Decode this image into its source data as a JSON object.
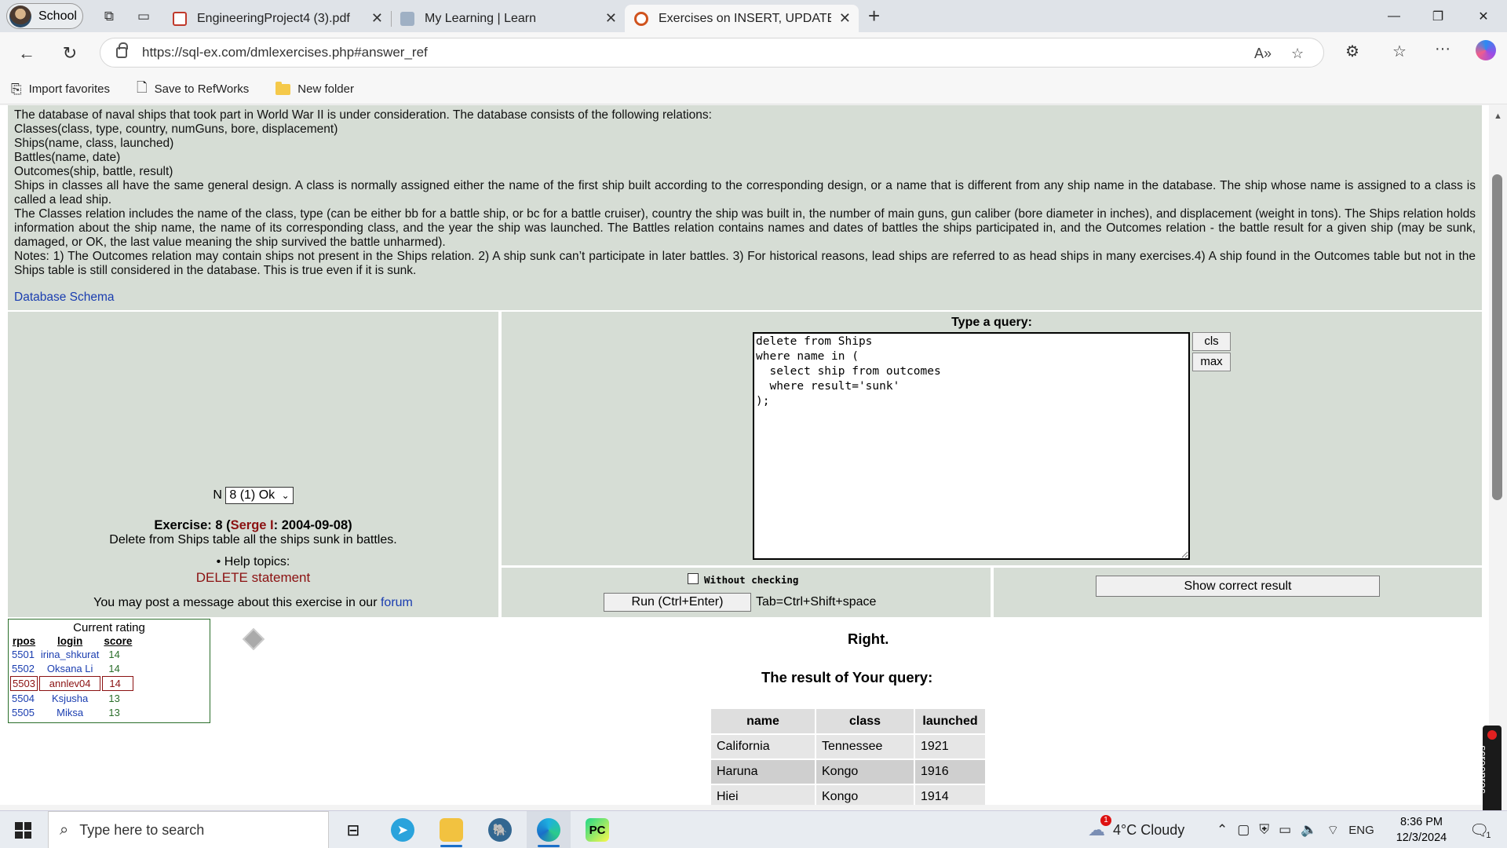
{
  "browser": {
    "profile_label": "School",
    "tabs": [
      {
        "title": "EngineeringProject4 (3).pdf",
        "icon": "pdf-icon"
      },
      {
        "title": "My Learning | Learn",
        "icon": "learn-icon"
      },
      {
        "title": "Exercises on INSERT, UPDATE, DEL",
        "icon": "sql-ex-icon"
      }
    ],
    "url": "https://sql-ex.com/dmlexercises.php#answer_ref",
    "favorites": [
      "Import favorites",
      "Save to RefWorks",
      "New folder"
    ]
  },
  "intro": {
    "lines": [
      "The database of naval ships that took part in World War II is under consideration. The database consists of the following relations:",
      "Classes(class, type, country, numGuns, bore, displacement)",
      "Ships(name, class, launched)",
      "Battles(name, date)",
      "Outcomes(ship, battle, result)",
      "Ships in classes all have the same general design. A class is normally assigned either the name of the first ship built according to the corresponding design, or a name that is different from any ship name in the database. The ship whose name is assigned to a class is called a lead ship.",
      "The Classes relation includes the name of the class, type (can be either bb for a battle ship, or bc for a battle cruiser), country the ship was built in, the number of main guns, gun caliber (bore diameter in inches), and displacement (weight in tons). The Ships relation holds information about the ship name, the name of its corresponding class, and the year the ship was launched. The Battles relation contains names and dates of battles the ships participated in, and the Outcomes relation - the battle result for a given ship (may be sunk, damaged, or OK, the last value meaning the ship survived the battle unharmed).",
      "Notes: 1) The Outcomes relation may contain ships not present in the Ships relation. 2) A ship sunk can’t participate in later battles. 3) For historical reasons, lead ships are referred to as head ships in many exercises.4) A ship found in the Outcomes table but not in the Ships table is still considered in the database. This is true even if it is sunk."
    ],
    "schema_link": "Database Schema"
  },
  "exercise": {
    "n_label": "N",
    "selected": "8 (1) Ok",
    "title_prefix": "Exercise: 8 (",
    "author": "Serge I",
    "title_suffix": ": 2004-09-08)",
    "description": "Delete from Ships table all the ships sunk in battles.",
    "help_label": "• Help topics:",
    "help_link": "DELETE statement",
    "forum_text": "You may post a message about this exercise in our",
    "forum_link": "forum"
  },
  "query": {
    "title": "Type a query:",
    "text": "delete from Ships\nwhere name in (\n  select ship from outcomes\n  where result='sunk'\n);",
    "cls_label": "cls",
    "max_label": "max",
    "without_checking": "Without checking",
    "run_label": "Run (Ctrl+Enter)",
    "tab_hint": "Tab=Ctrl+Shift+space",
    "show_result_label": "Show correct result"
  },
  "rating": {
    "title": "Current rating",
    "headers": [
      "rpos",
      "login",
      "score"
    ],
    "rows": [
      {
        "rpos": "5501",
        "login": "irina_shkurat",
        "score": "14"
      },
      {
        "rpos": "5502",
        "login": "Oksana Li",
        "score": "14"
      },
      {
        "rpos": "5503",
        "login": "annlev04",
        "score": "14"
      },
      {
        "rpos": "5504",
        "login": "Ksjusha",
        "score": "13"
      },
      {
        "rpos": "5505",
        "login": "Miksa",
        "score": "13"
      }
    ]
  },
  "result": {
    "status": "Right.",
    "title": "The result of Your query:",
    "headers": [
      "name",
      "class",
      "launched"
    ],
    "rows": [
      [
        "California",
        "Tennessee",
        "1921"
      ],
      [
        "Haruna",
        "Kongo",
        "1916"
      ],
      [
        "Hiei",
        "Kongo",
        "1914"
      ]
    ]
  },
  "screenrec_label": "screenrec",
  "taskbar": {
    "search_placeholder": "Type here to search",
    "weather": "4°C  Cloudy",
    "weather_badge": "1",
    "language": "ENG",
    "time": "8:36 PM",
    "date": "12/3/2024",
    "notification_count": "1"
  }
}
